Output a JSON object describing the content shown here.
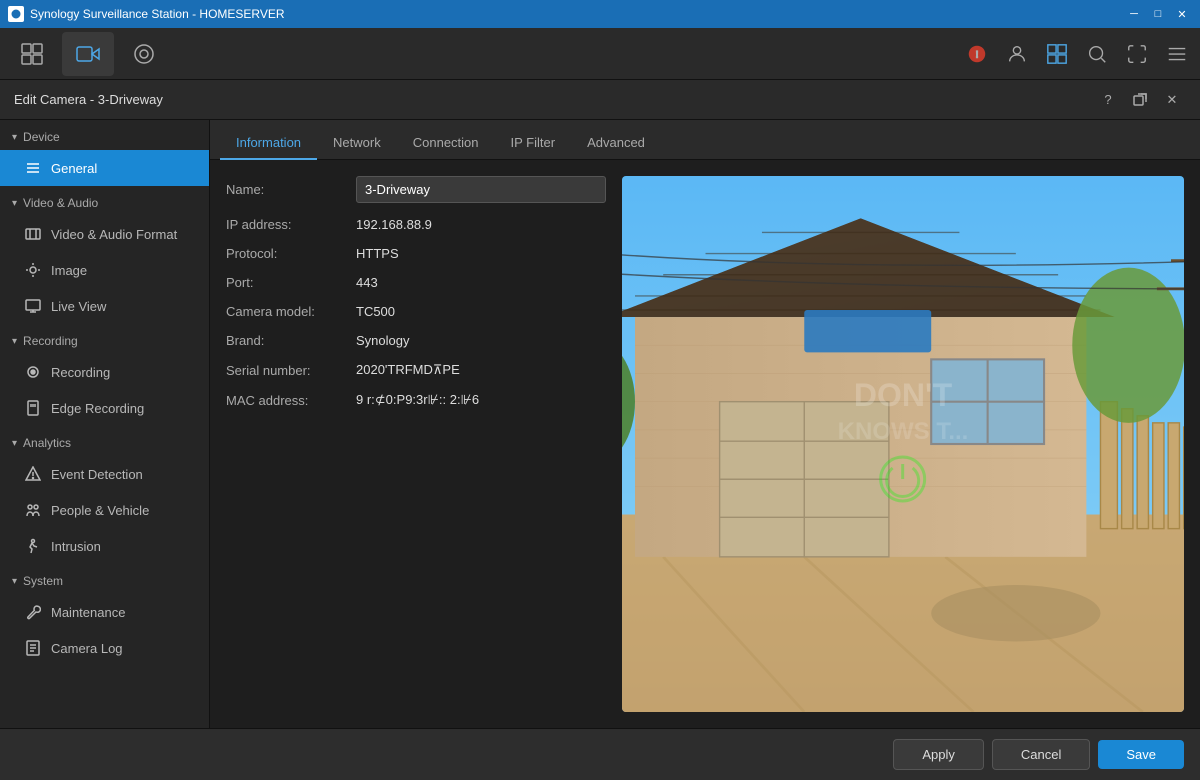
{
  "app": {
    "title": "Synology Surveillance Station - HOMESERVER",
    "icon": "📷"
  },
  "titlebar": {
    "title": "Synology Surveillance Station - HOMESERVER",
    "minimize": "─",
    "maximize": "□",
    "close": "✕"
  },
  "toolbar": {
    "btn1_icon": "grid",
    "btn2_icon": "camera",
    "btn3_icon": "lens"
  },
  "edit_camera": {
    "title": "Edit Camera - 3-Driveway",
    "tabs": [
      "Information",
      "Network",
      "Connection",
      "IP Filter",
      "Advanced"
    ]
  },
  "sidebar": {
    "device_section": "Device",
    "sections": [
      {
        "name": "device",
        "label": "Device",
        "items": [
          {
            "id": "general",
            "label": "General",
            "icon": "list",
            "active": true
          }
        ]
      },
      {
        "name": "video-audio",
        "label": "Video & Audio",
        "items": [
          {
            "id": "video-audio-format",
            "label": "Video & Audio Format",
            "icon": "film"
          },
          {
            "id": "image",
            "label": "Image",
            "icon": "sun"
          },
          {
            "id": "live-view",
            "label": "Live View",
            "icon": "monitor"
          }
        ]
      },
      {
        "name": "recording",
        "label": "Recording",
        "items": [
          {
            "id": "recording",
            "label": "Recording",
            "icon": "record"
          },
          {
            "id": "edge-recording",
            "label": "Edge Recording",
            "icon": "sd"
          }
        ]
      },
      {
        "name": "analytics",
        "label": "Analytics",
        "items": [
          {
            "id": "event-detection",
            "label": "Event Detection",
            "icon": "alert"
          },
          {
            "id": "people-vehicle",
            "label": "People & Vehicle",
            "icon": "people"
          },
          {
            "id": "intrusion",
            "label": "Intrusion",
            "icon": "walk"
          }
        ]
      },
      {
        "name": "system",
        "label": "System",
        "items": [
          {
            "id": "maintenance",
            "label": "Maintenance",
            "icon": "wrench"
          },
          {
            "id": "camera-log",
            "label": "Camera Log",
            "icon": "log"
          }
        ]
      }
    ]
  },
  "form": {
    "name_label": "Name:",
    "name_value": "3-Driveway",
    "ip_label": "IP address:",
    "ip_value": "192.168.88.9",
    "protocol_label": "Protocol:",
    "protocol_value": "HTTPS",
    "port_label": "Port:",
    "port_value": "443",
    "camera_model_label": "Camera model:",
    "camera_model_value": "TC500",
    "brand_label": "Brand:",
    "brand_value": "Synology",
    "serial_label": "Serial number:",
    "serial_value": "2020'TRFMD⊼PE",
    "mac_label": "MAC address:",
    "mac_value": "9 r:⊄0:P9:3r⊮:: 2:⊮6"
  },
  "footer": {
    "apply_label": "Apply",
    "cancel_label": "Cancel",
    "save_label": "Save"
  },
  "watermark": {
    "line1": "DON'T",
    "line2": "KNOWS T..."
  }
}
